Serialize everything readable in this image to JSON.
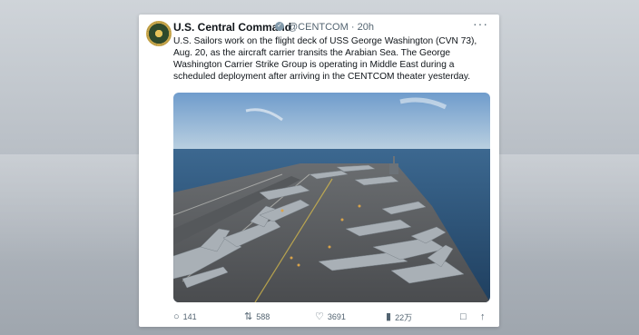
{
  "tweet": {
    "author_name": "U.S. Central Command",
    "handle": "@CENTCOM",
    "separator": "·",
    "time": "20h",
    "text": "U.S. Sailors work on the flight deck of USS George Washington (CVN 73), Aug. 20, as the aircraft carrier transits the Arabian Sea. The George Washington Carrier Strike Group is operating in Middle East during a scheduled deployment after arriving in the CENTCOM theater yesterday.",
    "verified_icon": "verified-badge-icon",
    "more_icon": "more-options-icon",
    "media_icon": "aircraft-carrier-photo"
  },
  "actions": {
    "replies": "141",
    "retweets": "588",
    "likes": "3691",
    "views": "22万",
    "icons": {
      "reply": "reply-icon",
      "retweet": "retweet-icon",
      "like": "heart-icon",
      "views": "views-chart-icon",
      "bookmark": "bookmark-icon",
      "share": "share-icon"
    }
  }
}
